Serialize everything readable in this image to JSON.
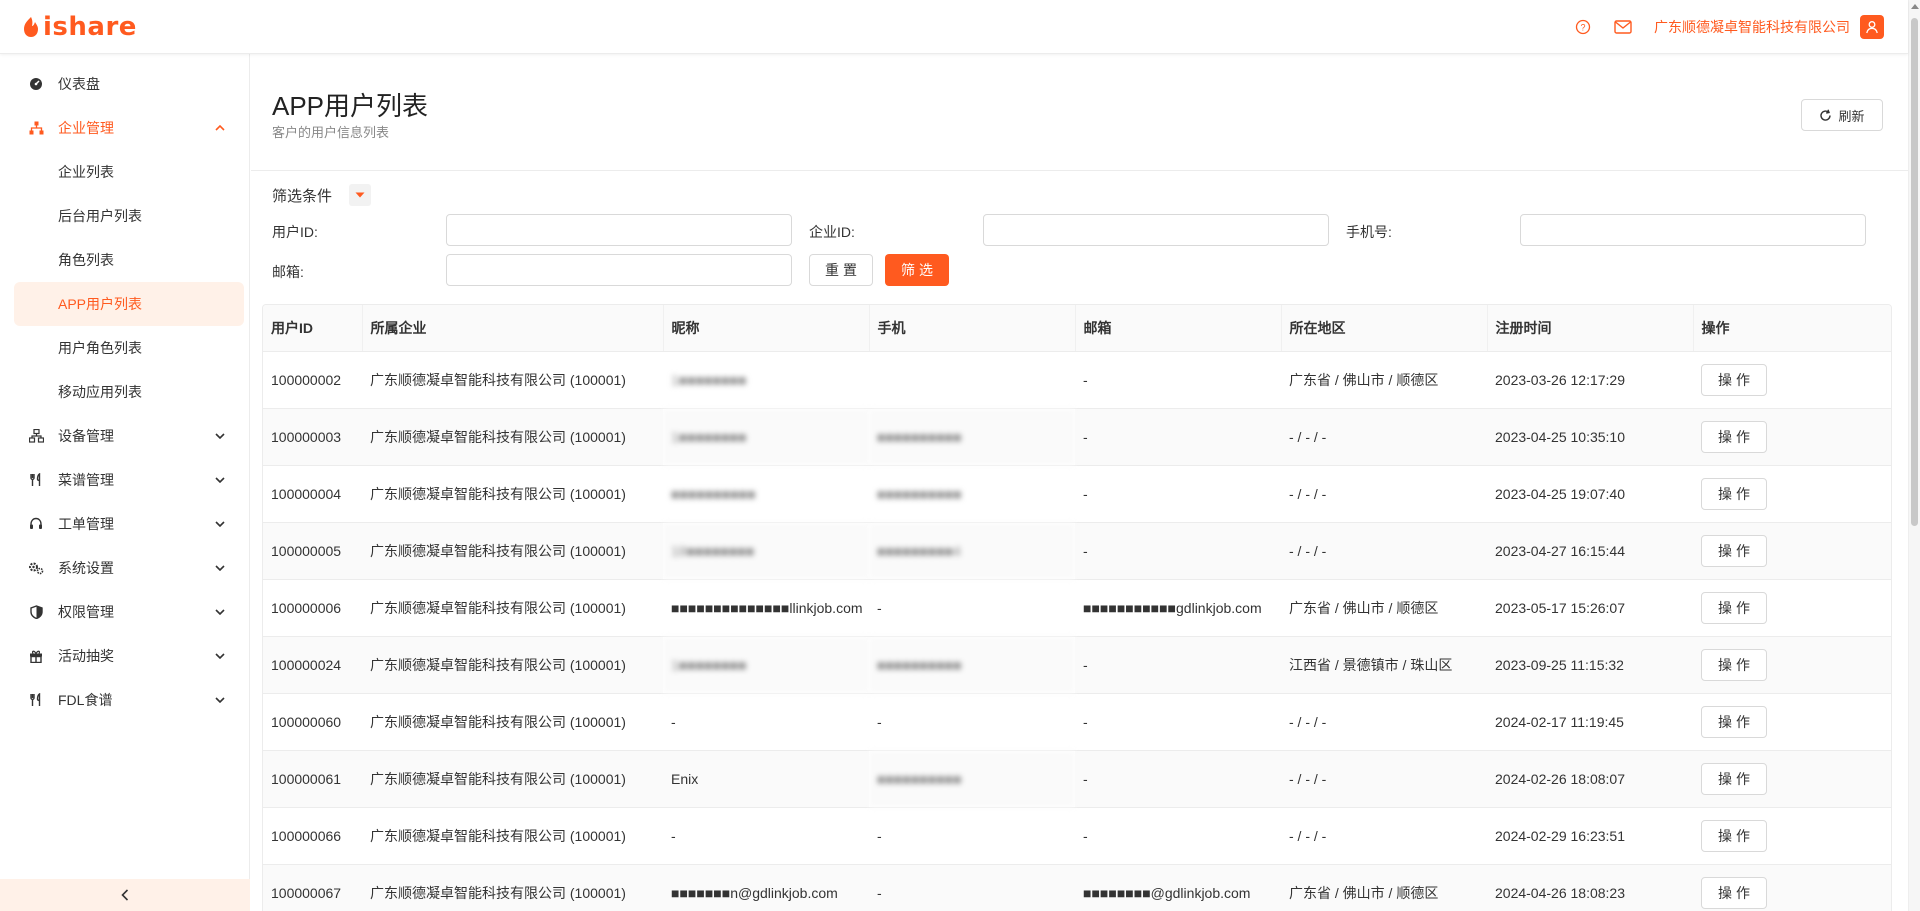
{
  "header": {
    "logo_text": "ishare",
    "company": "广东顺德凝卓智能科技有限公司",
    "accent": "#ff5a1f"
  },
  "sidebar": {
    "items": [
      {
        "label": "仪表盘",
        "icon": "dashboard-icon"
      },
      {
        "label": "企业管理",
        "icon": "sitemap-icon",
        "open": true
      },
      {
        "label": "设备管理",
        "icon": "network-icon"
      },
      {
        "label": "菜谱管理",
        "icon": "utensils-icon"
      },
      {
        "label": "工单管理",
        "icon": "headset-icon"
      },
      {
        "label": "系统设置",
        "icon": "gears-icon"
      },
      {
        "label": "权限管理",
        "icon": "shield-icon"
      },
      {
        "label": "活动抽奖",
        "icon": "gift-icon"
      },
      {
        "label": "FDL食谱",
        "icon": "utensils-icon"
      }
    ],
    "submenu": [
      {
        "label": "企业列表"
      },
      {
        "label": "后台用户列表"
      },
      {
        "label": "角色列表"
      },
      {
        "label": "APP用户列表",
        "active": true
      },
      {
        "label": "用户角色列表"
      },
      {
        "label": "移动应用列表"
      }
    ]
  },
  "page": {
    "title": "APP用户列表",
    "subtitle": "客户的用户信息列表",
    "refresh_label": "刷新"
  },
  "filter": {
    "title": "筛选条件",
    "user_id_label": "用户ID:",
    "company_id_label": "企业ID:",
    "phone_label": "手机号:",
    "email_label": "邮箱:",
    "reset_label": "重置",
    "submit_label": "筛选",
    "user_id_value": "",
    "company_id_value": "",
    "phone_value": "",
    "email_value": ""
  },
  "table": {
    "columns": [
      "用户ID",
      "所属企业",
      "昵称",
      "手机",
      "邮箱",
      "所在地区",
      "注册时间",
      "操作"
    ],
    "op_label": "操作",
    "rows": [
      {
        "id": "100000002",
        "company": "广东顺德凝卓智能科技有限公司 (100001)",
        "nickname": "1■■■■■■■■",
        "nickname_blur": true,
        "phone": "",
        "phone_blur": false,
        "email": "-",
        "email_blur": false,
        "region": "广东省 / 佛山市 / 顺德区",
        "time": "2023-03-26 12:17:29"
      },
      {
        "id": "100000003",
        "company": "广东顺德凝卓智能科技有限公司 (100001)",
        "nickname": "1■■■■■■■■",
        "nickname_blur": true,
        "phone": "■■■■■■■■■■",
        "phone_blur": true,
        "email": "-",
        "email_blur": false,
        "region": "- / - / -",
        "time": "2023-04-25 10:35:10"
      },
      {
        "id": "100000004",
        "company": "广东顺德凝卓智能科技有限公司 (100001)",
        "nickname": "■■■■■■■■■■",
        "nickname_blur": true,
        "phone": "■■■■■■■■■■",
        "phone_blur": true,
        "email": "-",
        "email_blur": false,
        "region": "- / - / -",
        "time": "2023-04-25 19:07:40"
      },
      {
        "id": "100000005",
        "company": "广东顺德凝卓智能科技有限公司 (100001)",
        "nickname": "18■■■■■■■■",
        "nickname_blur": true,
        "phone": "■■■■■■■■■4",
        "phone_blur": true,
        "email": "-",
        "email_blur": false,
        "region": "- / - / -",
        "time": "2023-04-27 16:15:44"
      },
      {
        "id": "100000006",
        "company": "广东顺德凝卓智能科技有限公司 (100001)",
        "nickname": "■■■■■■■■■■■■■■llinkjob.com",
        "nickname_blur": false,
        "phone": "-",
        "phone_blur": false,
        "email": "■■■■■■■■■■■gdlinkjob.com",
        "email_blur": false,
        "region": "广东省 / 佛山市 / 顺德区",
        "time": "2023-05-17 15:26:07"
      },
      {
        "id": "100000024",
        "company": "广东顺德凝卓智能科技有限公司 (100001)",
        "nickname": "1■■■■■■■■",
        "nickname_blur": true,
        "phone": "■■■■■■■■■■",
        "phone_blur": true,
        "email": "-",
        "email_blur": false,
        "region": "江西省 / 景德镇市 / 珠山区",
        "time": "2023-09-25 11:15:32"
      },
      {
        "id": "100000060",
        "company": "广东顺德凝卓智能科技有限公司 (100001)",
        "nickname": "-",
        "nickname_blur": false,
        "phone": "-",
        "phone_blur": false,
        "email": "-",
        "email_blur": false,
        "region": "- / - / -",
        "time": "2024-02-17 11:19:45"
      },
      {
        "id": "100000061",
        "company": "广东顺德凝卓智能科技有限公司 (100001)",
        "nickname": "Enix",
        "nickname_blur": false,
        "phone": "■■■■■■■■■■",
        "phone_blur": true,
        "email": "-",
        "email_blur": false,
        "region": "- / - / -",
        "time": "2024-02-26 18:08:07"
      },
      {
        "id": "100000066",
        "company": "广东顺德凝卓智能科技有限公司 (100001)",
        "nickname": "-",
        "nickname_blur": false,
        "phone": "-",
        "phone_blur": false,
        "email": "-",
        "email_blur": false,
        "region": "- / - / -",
        "time": "2024-02-29 16:23:51"
      },
      {
        "id": "100000067",
        "company": "广东顺德凝卓智能科技有限公司 (100001)",
        "nickname": "■■■■■■■n@gdlinkjob.com",
        "nickname_blur": false,
        "phone": "-",
        "phone_blur": false,
        "email": "■■■■■■■■@gdlinkjob.com",
        "email_blur": false,
        "region": "广东省 / 佛山市 / 顺德区",
        "time": "2024-04-26 18:08:23"
      }
    ]
  }
}
